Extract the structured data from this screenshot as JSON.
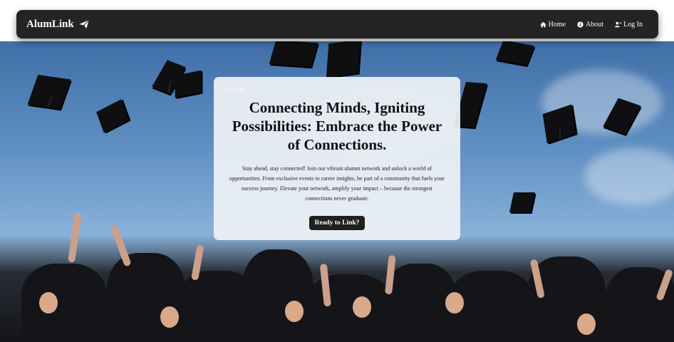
{
  "navbar": {
    "brand": "AlumLink",
    "brand_icon": "paper-plane-icon",
    "items": [
      {
        "label": "Home",
        "icon": "home-icon"
      },
      {
        "label": "About",
        "icon": "info-circle-icon"
      },
      {
        "label": "Log In",
        "icon": "user-login-icon"
      }
    ]
  },
  "hero": {
    "watermark": "AlumLink",
    "title": "Connecting Minds, Igniting Possibilities: Embrace the Power of Connections.",
    "description": "Stay ahead, stay connected! Join our vibrant alumni network and unlock a world of opportunities. From exclusive events to career insights, be part of a community that fuels your success journey. Elevate your network, amplify your impact – because the strongest connections never graduate.",
    "cta_label": "Ready to Link?"
  },
  "colors": {
    "navbar_bg": "#242424",
    "card_bg": "#eef1f5",
    "button_bg": "#1f1f1f",
    "sky": "#5f8fc2"
  }
}
